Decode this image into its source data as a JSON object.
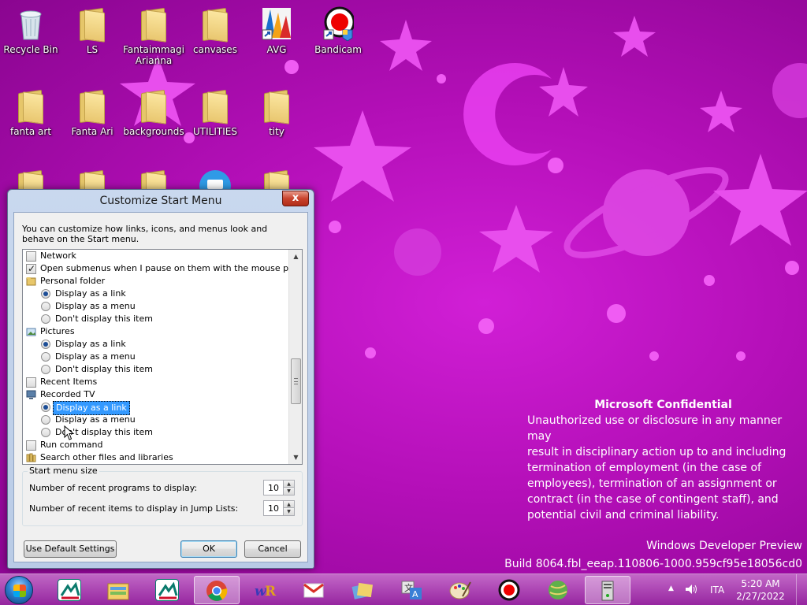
{
  "desktop": {
    "icons": [
      {
        "label": "Recycle Bin"
      },
      {
        "label": "LS"
      },
      {
        "label": "Fantaimmagi Arianna"
      },
      {
        "label": "canvases"
      },
      {
        "label": "AVG"
      },
      {
        "label": "Bandicam"
      },
      {
        "label": "fanta art"
      },
      {
        "label": "Fanta Ari"
      },
      {
        "label": "backgrounds"
      },
      {
        "label": "UTILITIES"
      },
      {
        "label": "tity"
      }
    ],
    "confidential": {
      "title": "Microsoft Confidential",
      "lines": [
        "Unauthorized use or disclosure in any manner may",
        "result in disciplinary action up to and including",
        "termination of employment (in the case of",
        "employees), termination of an assignment or",
        "contract (in the case of contingent staff), and",
        "potential civil and criminal liability."
      ]
    },
    "build": {
      "line1": "Windows Developer Preview",
      "line2": "Build 8064.fbl_eeap.110806-1000.959cf95e18056cd0"
    }
  },
  "dialog": {
    "title": "Customize Start Menu",
    "close_label": "x",
    "intro": "You can customize how links, icons, and menus look and behave on the Start menu.",
    "items": [
      {
        "type": "checkbox",
        "label": "Network",
        "checked": false
      },
      {
        "type": "checkbox",
        "label": "Open submenus when I pause on them with the mouse pointer",
        "checked": true
      },
      {
        "type": "header",
        "label": "Personal folder",
        "icon": "folder-icon"
      },
      {
        "type": "radio",
        "label": "Display as a link",
        "checked": true
      },
      {
        "type": "radio",
        "label": "Display as a menu",
        "checked": false
      },
      {
        "type": "radio",
        "label": "Don't display this item",
        "checked": false
      },
      {
        "type": "header",
        "label": "Pictures",
        "icon": "pictures-icon"
      },
      {
        "type": "radio",
        "label": "Display as a link",
        "checked": true
      },
      {
        "type": "radio",
        "label": "Display as a menu",
        "checked": false
      },
      {
        "type": "radio",
        "label": "Don't display this item",
        "checked": false
      },
      {
        "type": "checkbox",
        "label": "Recent Items",
        "checked": false
      },
      {
        "type": "header",
        "label": "Recorded TV",
        "icon": "tv-icon"
      },
      {
        "type": "radio",
        "label": "Display as a link",
        "checked": true,
        "selected": true
      },
      {
        "type": "radio",
        "label": "Display as a menu",
        "checked": false
      },
      {
        "type": "radio",
        "label": "Don't display this item",
        "checked": false
      },
      {
        "type": "checkbox",
        "label": "Run command",
        "checked": false
      },
      {
        "type": "header",
        "label": "Search other files and libraries",
        "icon": "search-libraries-icon"
      }
    ],
    "start_menu_size": {
      "title": "Start menu size",
      "recent_programs_label": "Number of recent programs to display:",
      "recent_programs_value": "10",
      "recent_items_label": "Number of recent items to display in Jump Lists:",
      "recent_items_value": "10"
    },
    "buttons": {
      "default_settings": "Use Default Settings",
      "ok": "OK",
      "cancel": "Cancel"
    }
  },
  "taskbar": {
    "apps": [
      "credit-agricole",
      "file-explorer",
      "credit-agricole",
      "chrome",
      "wr",
      "gmail",
      "folders",
      "translator",
      "paint",
      "bandicam",
      "maps",
      "server"
    ],
    "active_indices": [
      3,
      11
    ],
    "language": "ITA",
    "time": "5:20 AM",
    "date": "2/27/2022"
  },
  "colors": {
    "wallpaper": "#b40fb8",
    "wallpaper_shapes": "#e23ee6",
    "selection": "#3399ff"
  }
}
